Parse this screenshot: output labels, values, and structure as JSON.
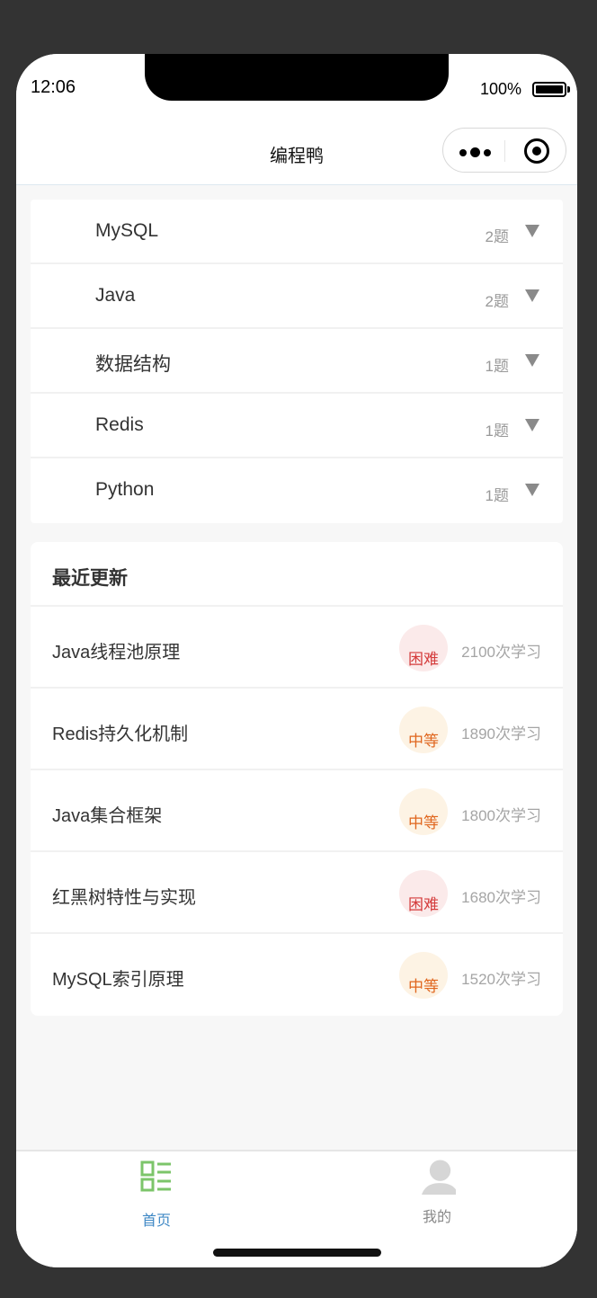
{
  "status": {
    "time": "12:06",
    "battery": "100%"
  },
  "nav": {
    "title": "编程鸭"
  },
  "categories": [
    {
      "name": "MySQL",
      "count": "2题"
    },
    {
      "name": "Java",
      "count": "2题"
    },
    {
      "name": "数据结构",
      "count": "1题"
    },
    {
      "name": "Redis",
      "count": "1题"
    },
    {
      "name": "Python",
      "count": "1题"
    }
  ],
  "recent": {
    "title": "最近更新",
    "items": [
      {
        "name": "Java线程池原理",
        "difficulty": "困难",
        "count": "2100次学习"
      },
      {
        "name": "Redis持久化机制",
        "difficulty": "中等",
        "count": "1890次学习"
      },
      {
        "name": "Java集合框架",
        "difficulty": "中等",
        "count": "1800次学习"
      },
      {
        "name": "红黑树特性与实现",
        "difficulty": "困难",
        "count": "1680次学习"
      },
      {
        "name": "MySQL索引原理",
        "difficulty": "中等",
        "count": "1520次学习"
      }
    ]
  },
  "tabs": {
    "home": {
      "label": "首页",
      "icon": "home-grid-icon"
    },
    "mine": {
      "label": "我的",
      "icon": "user-icon"
    }
  },
  "colors": {
    "accent": "#3f88c5",
    "hard": "#d43c3c",
    "medium": "#e0661e",
    "home_icon": "#7cc56a"
  }
}
